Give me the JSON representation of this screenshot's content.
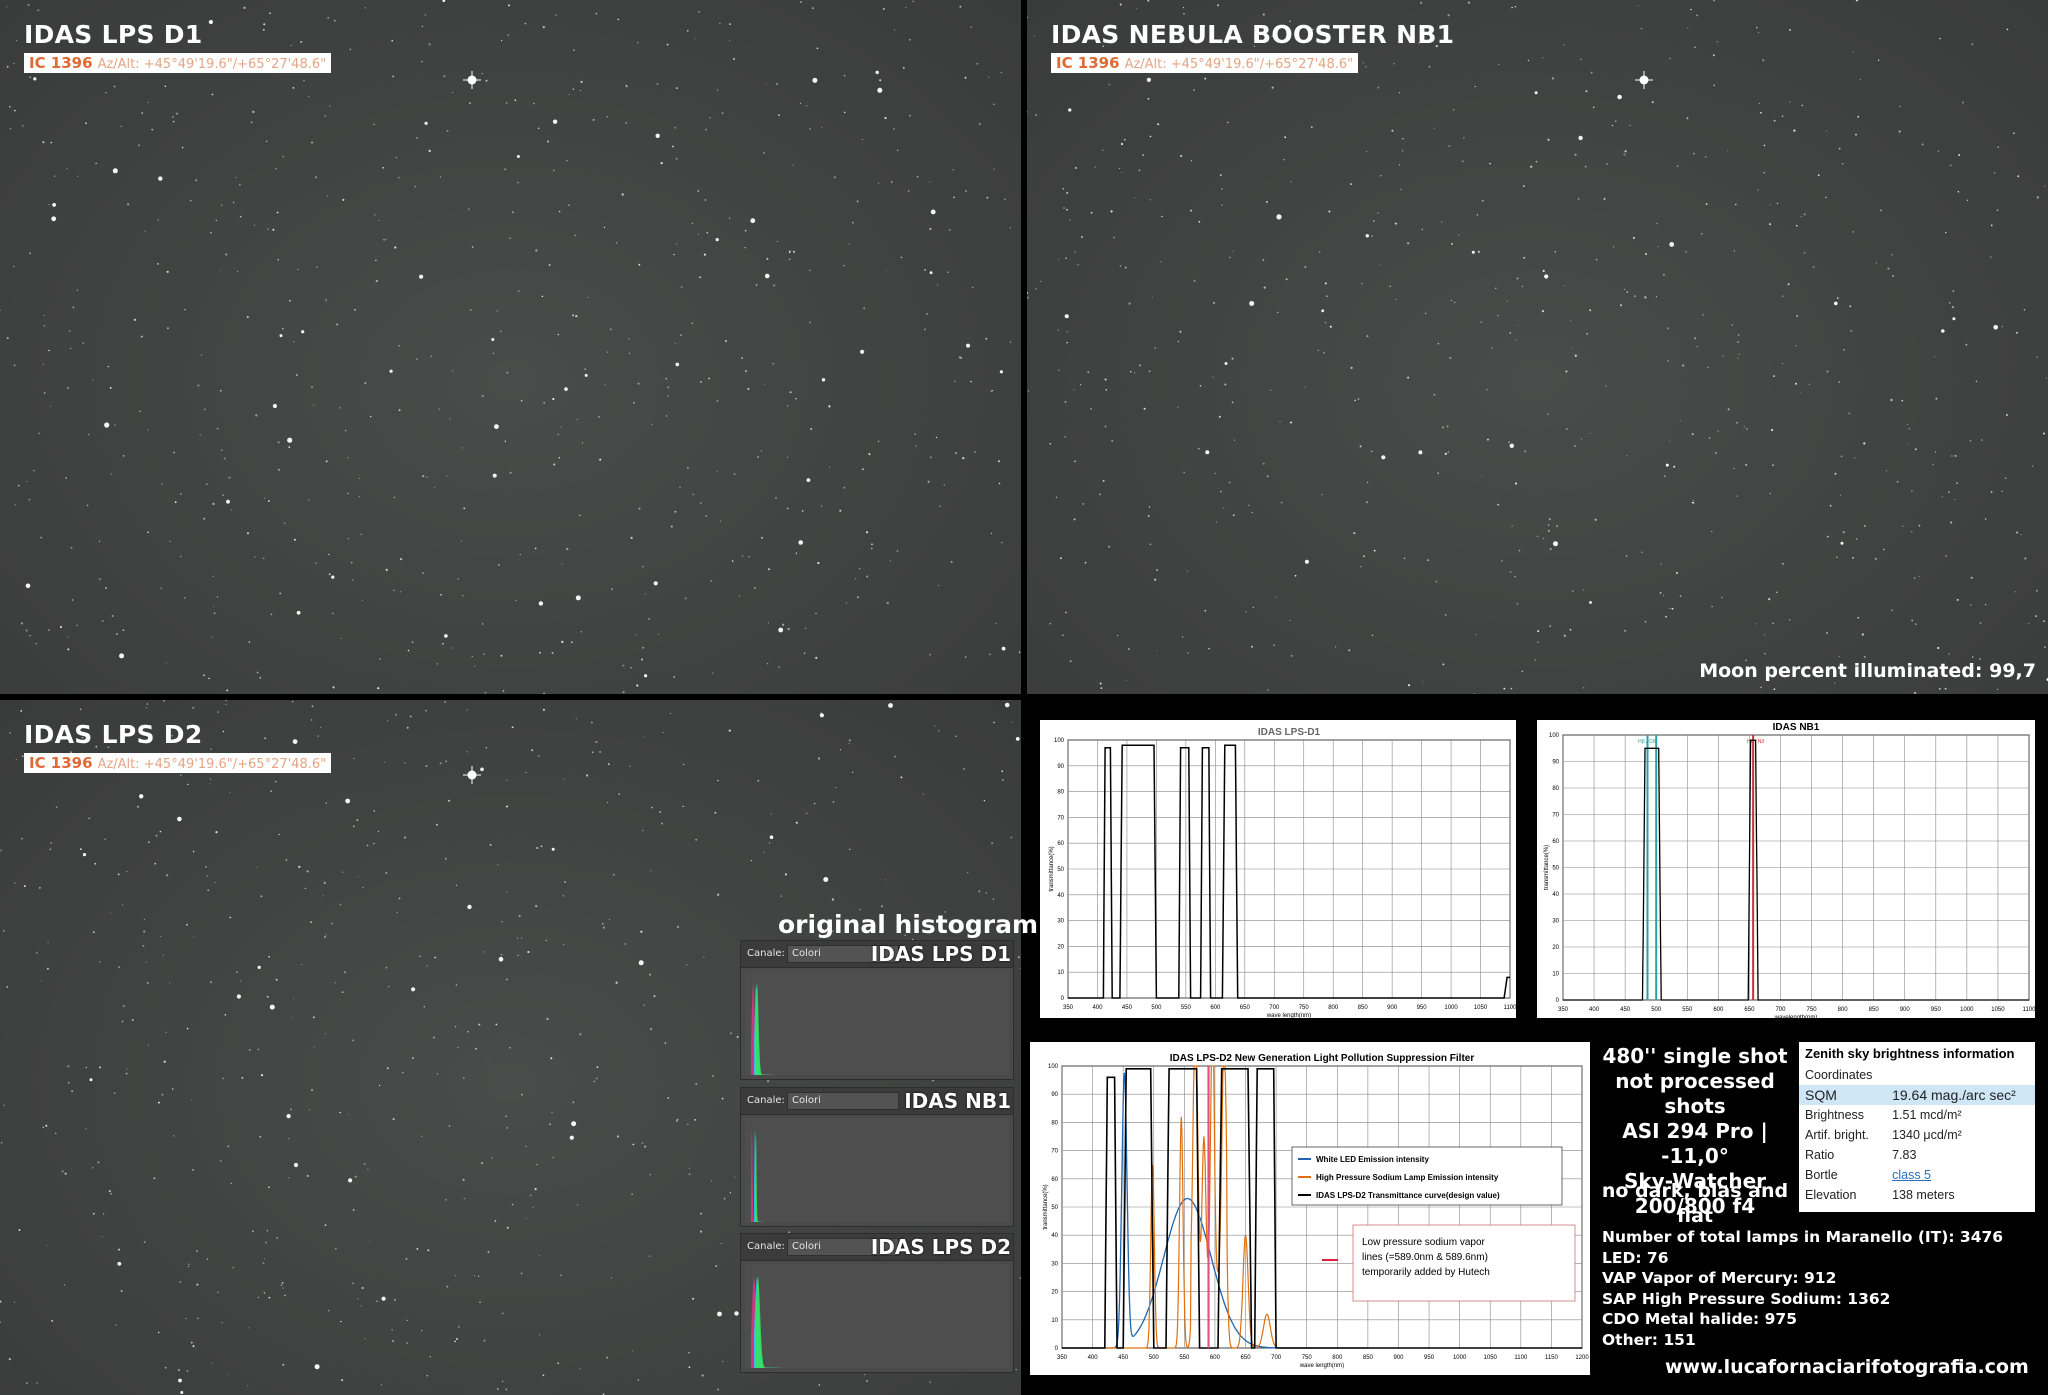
{
  "panels": {
    "d1": {
      "title": "IDAS LPS D1",
      "object": "IC 1396",
      "azalt": "Az/Alt: +45°49'19.6\"/+65°27'48.6\""
    },
    "nb1": {
      "title": "IDAS NEBULA BOOSTER NB1",
      "object": "IC 1396",
      "azalt": "Az/Alt: +45°49'19.6\"/+65°27'48.6\"",
      "moon": "Moon percent illuminated: 99,7"
    },
    "d2": {
      "title": "IDAS LPS D2",
      "object": "IC 1396",
      "azalt": "Az/Alt: +45°49'19.6\"/+65°27'48.6\""
    }
  },
  "histogram": {
    "title": "original histogram",
    "channel_label": "Canale:",
    "channel_value": "Colori",
    "panels": [
      {
        "label": "IDAS LPS D1",
        "spread": 14
      },
      {
        "label": "IDAS NB1",
        "spread": 6
      },
      {
        "label": "IDAS LPS D2",
        "spread": 20
      }
    ]
  },
  "charts": {
    "d1": {
      "title": "IDAS LPS-D1",
      "ylabel": "transmittance(%)",
      "xlabel": "wave length(nm)",
      "xticks": [
        "350",
        "400",
        "450",
        "500",
        "550",
        "600",
        "650",
        "700",
        "750",
        "800",
        "850",
        "900",
        "950",
        "1000",
        "1050",
        "1100"
      ],
      "yticks": [
        "0",
        "10",
        "20",
        "30",
        "40",
        "50",
        "60",
        "70",
        "80",
        "90",
        "100"
      ]
    },
    "nb1": {
      "title": "IDAS NB1",
      "ylabel": "transmittance(%)",
      "xlabel": "wavelength(nm)",
      "line_label_1": "Hβ / OIII",
      "line_label_2": "Hα / NII",
      "xticks": [
        "350",
        "400",
        "450",
        "500",
        "550",
        "600",
        "650",
        "700",
        "750",
        "800",
        "850",
        "900",
        "950",
        "1000",
        "1050",
        "1100"
      ],
      "yticks": [
        "0",
        "10",
        "20",
        "30",
        "40",
        "50",
        "60",
        "70",
        "80",
        "90",
        "100"
      ]
    },
    "d2": {
      "title": "IDAS   LPS-D2    New Generation Light Pollution Suppression Filter",
      "ylabel": "transmittance(%)",
      "xlabel": "wave length(nm)",
      "legend": [
        {
          "label": "White LED   Emission intensity",
          "color": "#1f66b2"
        },
        {
          "label": "High Pressure Sodium Lamp   Emission intensity",
          "color": "#e0700f"
        },
        {
          "label": "IDAS LPS-D2   Transmittance curve(design value)",
          "color": "#000000"
        }
      ],
      "note": [
        "Low pressure sodium vapor",
        "lines (=589.0nm & 589.6nm)",
        "temporarily added by Hutech"
      ],
      "xticks": [
        "350",
        "400",
        "450",
        "500",
        "550",
        "600",
        "650",
        "700",
        "750",
        "800",
        "850",
        "900",
        "950",
        "1000",
        "1050",
        "1100",
        "1150",
        "1200"
      ],
      "yticks": [
        "0",
        "10",
        "20",
        "30",
        "40",
        "50",
        "60",
        "70",
        "80",
        "90",
        "100"
      ]
    }
  },
  "shot_info": [
    "480'' single shot",
    "not processed shots",
    "ASI 294 Pro | -11,0°",
    "Sky-Watcher",
    "200/800 f4"
  ],
  "calib_info": "no dark, bias and flat",
  "zenith": {
    "title": "Zenith sky brightness information",
    "rows": [
      {
        "k": "Coordinates",
        "v": ""
      },
      {
        "k": "SQM",
        "v": "19.64 mag./arc sec²"
      },
      {
        "k": "Brightness",
        "v": "1.51 mcd/m²"
      },
      {
        "k": "Artif. bright.",
        "v": "1340 μcd/m²"
      },
      {
        "k": "Ratio",
        "v": "7.83"
      },
      {
        "k": "Bortle",
        "v": "class 5"
      },
      {
        "k": "Elevation",
        "v": "138 meters"
      }
    ]
  },
  "lamps": [
    "Number of total lamps in Maranello (IT): 3476",
    "LED: 76",
    "VAP Vapor of Mercury: 912",
    "SAP High Pressure Sodium: 1362",
    "CDO Metal halide: 975",
    "Other: 151"
  ],
  "website": "www.lucafornaciarifotografia.com"
}
